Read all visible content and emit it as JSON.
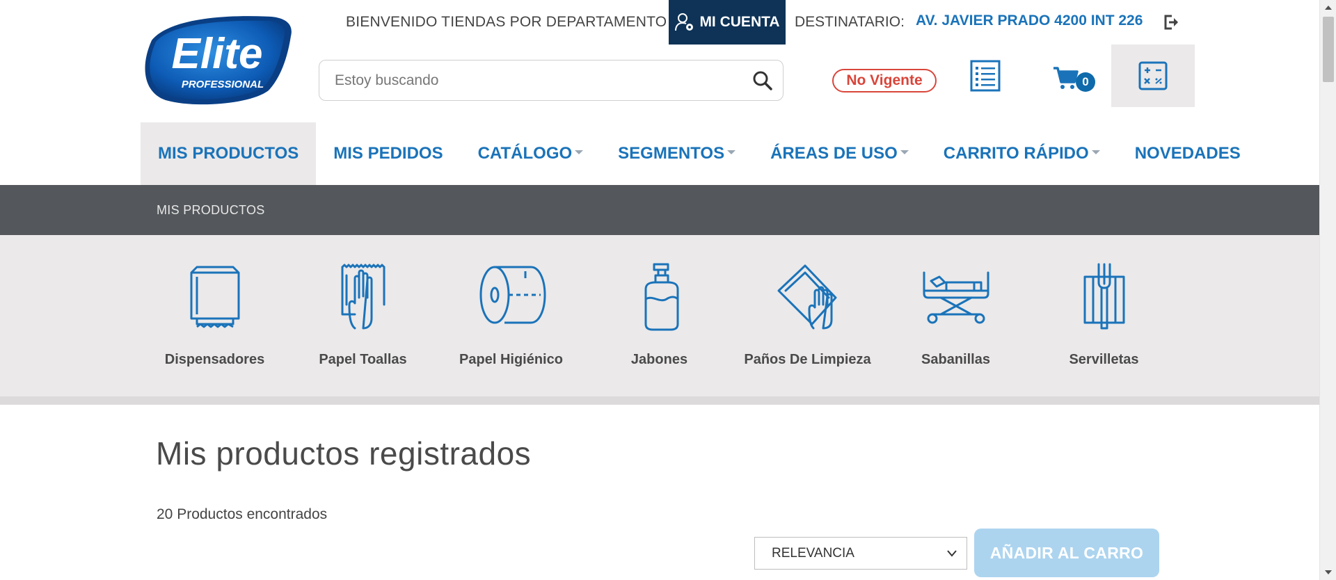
{
  "brand": {
    "logo_text": "Elite",
    "logo_subtext": "PROFESSIONAL",
    "primary_color": "#1a73b9",
    "dark_color": "#0e3357"
  },
  "header": {
    "welcome": "BIENVENIDO TIENDAS POR DEPARTAMENTO",
    "account_label": "MI CUENTA",
    "recipient_label": "DESTINATARIO:",
    "recipient_value": "AV. JAVIER PRADO 4200 INT 226",
    "search_placeholder": "Estoy buscando",
    "status_badge": "No Vigente",
    "cart_count": "0"
  },
  "nav": {
    "items": [
      {
        "label": "MIS PRODUCTOS",
        "active": true,
        "dropdown": false
      },
      {
        "label": "MIS PEDIDOS",
        "active": false,
        "dropdown": false
      },
      {
        "label": "CATÁLOGO",
        "active": false,
        "dropdown": true
      },
      {
        "label": "SEGMENTOS",
        "active": false,
        "dropdown": true
      },
      {
        "label": "ÁREAS DE USO",
        "active": false,
        "dropdown": true
      },
      {
        "label": "CARRITO RÁPIDO",
        "active": false,
        "dropdown": true
      },
      {
        "label": "NOVEDADES",
        "active": false,
        "dropdown": false
      }
    ]
  },
  "breadcrumb": "MIS PRODUCTOS",
  "categories": [
    {
      "label": "Dispensadores",
      "icon": "dispenser-icon"
    },
    {
      "label": "Papel Toallas",
      "icon": "paper-towel-icon"
    },
    {
      "label": "Papel Higiénico",
      "icon": "toilet-paper-icon"
    },
    {
      "label": "Jabones",
      "icon": "soap-icon"
    },
    {
      "label": "Paños De Limpieza",
      "icon": "cleaning-cloth-icon"
    },
    {
      "label": "Sabanillas",
      "icon": "stretcher-icon"
    },
    {
      "label": "Servilletas",
      "icon": "napkin-icon"
    }
  ],
  "main": {
    "title": "Mis productos registrados",
    "results_count": "20 Productos encontrados",
    "sort_selected": "RELEVANCIA",
    "add_to_cart_label": "AÑADIR AL CARRO"
  }
}
